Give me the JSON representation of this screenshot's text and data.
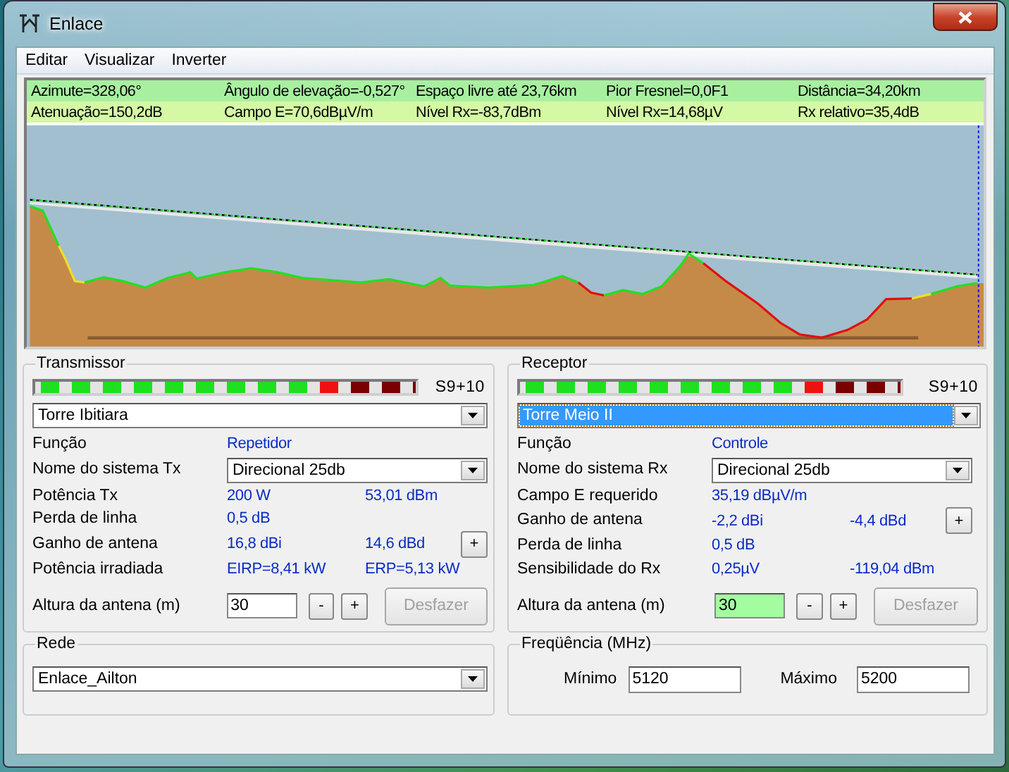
{
  "window": {
    "title": "Enlace"
  },
  "menu": [
    "Editar",
    "Visualizar",
    "Inverter"
  ],
  "info_rows": [
    {
      "cells": [
        "Azimute=328,06°",
        "Ângulo de elevação=-0,527°",
        "Espaço livre até 23,76km",
        "Pior Fresnel=0,0F1",
        "Distância=34,20km"
      ]
    },
    {
      "cells": [
        "Atenuação=150,2dB",
        "Campo E=70,6dBµV/m",
        "Nível Rx=-83,7dBm",
        "Nível Rx=14,68µV",
        "Rx relativo=35,4dB"
      ]
    }
  ],
  "transmitter": {
    "title": "Transmissor",
    "meter": {
      "level": 1,
      "reading": "S9+10"
    },
    "station": {
      "value": "Torre Ibitiara",
      "highlighted": false
    },
    "rows": [
      {
        "kind": "value",
        "label": "Função",
        "value": "Repetidor"
      },
      {
        "kind": "select",
        "label": "Nome do sistema Tx",
        "value": "Direcional 25db"
      },
      {
        "kind": "value",
        "label": "Potência Tx",
        "value": "200 W",
        "value2": "53,01 dBm"
      },
      {
        "kind": "value",
        "label": "Perda de linha",
        "value": "0,5 dB"
      },
      {
        "kind": "value",
        "label": "Ganho de antena",
        "value": "16,8 dBi",
        "value2": "14,6 dBd",
        "button": "+"
      },
      {
        "kind": "value",
        "label": "Potência irradiada",
        "value": "EIRP=8,41 kW",
        "value2": "ERP=5,13 kW"
      }
    ],
    "height": {
      "label": "Altura da antena (m)",
      "value": "30",
      "highlighted": false,
      "minus": "-",
      "plus": "+",
      "undo": {
        "label": "Desfazer",
        "disabled": true
      }
    }
  },
  "receiver": {
    "title": "Receptor",
    "meter": {
      "level": 1,
      "reading": "S9+10"
    },
    "station": {
      "value": "Torre Meio II",
      "highlighted": true
    },
    "rows": [
      {
        "kind": "value",
        "label": "Função",
        "value": "Controle"
      },
      {
        "kind": "select",
        "label": "Nome do sistema Rx",
        "value": "Direcional 25db"
      },
      {
        "kind": "value",
        "label": "Campo E requerido",
        "value": "35,19 dBµV/m"
      },
      {
        "kind": "value",
        "label": "Ganho de antena",
        "value": "-2,2 dBi",
        "value2": "-4,4 dBd",
        "button": "+"
      },
      {
        "kind": "value",
        "label": "Perda de linha",
        "value": "0,5 dB"
      },
      {
        "kind": "value",
        "label": "Sensibilidade do Rx",
        "value": "0,25µV",
        "value2": "-119,04 dBm"
      }
    ],
    "height": {
      "label": "Altura da antena (m)",
      "value": "30",
      "highlighted": true,
      "minus": "-",
      "plus": "+",
      "undo": {
        "label": "Desfazer",
        "disabled": true
      }
    }
  },
  "network": {
    "title": "Rede",
    "value": "Enlace_Ailton"
  },
  "frequency": {
    "title": "Freqüência (MHz)",
    "min": {
      "label": "Mínimo",
      "value": "5120"
    },
    "max": {
      "label": "Máximo",
      "value": "5200"
    }
  }
}
